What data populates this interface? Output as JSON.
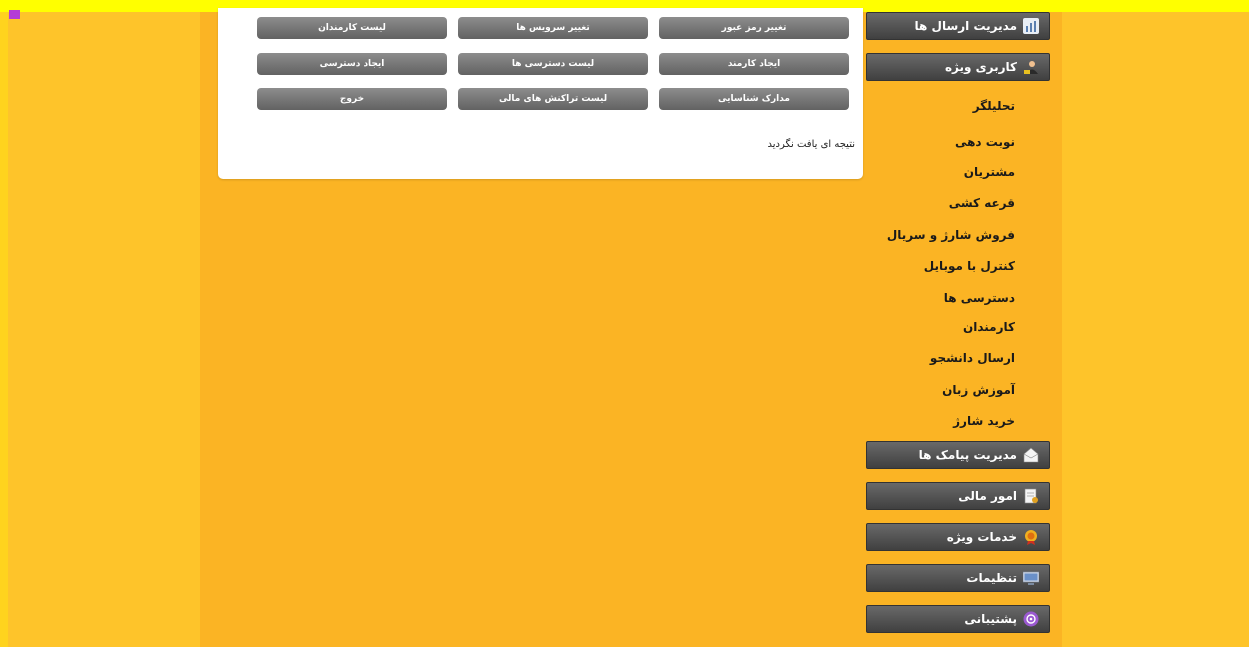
{
  "panel": {
    "buttons_row1": [
      "تغییر رمز عبور",
      "تغییر سرویس ها",
      "لیست کارمندان"
    ],
    "buttons_row2": [
      "ایجاد کارمند",
      "لیست دسترسی ها",
      "ایجاد دسترسی"
    ],
    "buttons_row3": [
      "مدارک شناسایی",
      "لیست تراکنش های مالی",
      "خروج"
    ],
    "no_result": "نتیجه ای یافت نگردید"
  },
  "menu": {
    "send_mgmt": "مدیریت ارسال ها",
    "special_user": "کاربری ویژه",
    "sub_items": [
      "تحلیلگر",
      "نوبت دهی",
      "مشتریان",
      "قرعه کشی",
      "فروش شارژ و سریال",
      "کنترل با موبایل",
      "دسترسی ها",
      "کارمندان",
      "ارسال دانشجو",
      "آموزش زبان",
      "خرید شارژ"
    ],
    "sms_mgmt": "مدیریت پیامک ها",
    "finance": "امور مالی",
    "special_services": "خدمات ویژه",
    "settings": "تنظیمات",
    "support": "پشتیبانی"
  },
  "icons": {
    "send_mgmt": "chart-icon",
    "special_user": "user-icon",
    "sms_mgmt": "envelope-icon",
    "finance": "invoice-icon",
    "special_services": "medal-icon",
    "settings": "monitor-icon",
    "support": "support-icon"
  },
  "colors": {
    "page_bg": "#fbb424",
    "top_bar": "#ffff00",
    "menu_button": "#4a4a4a",
    "panel_button": "#777777"
  }
}
